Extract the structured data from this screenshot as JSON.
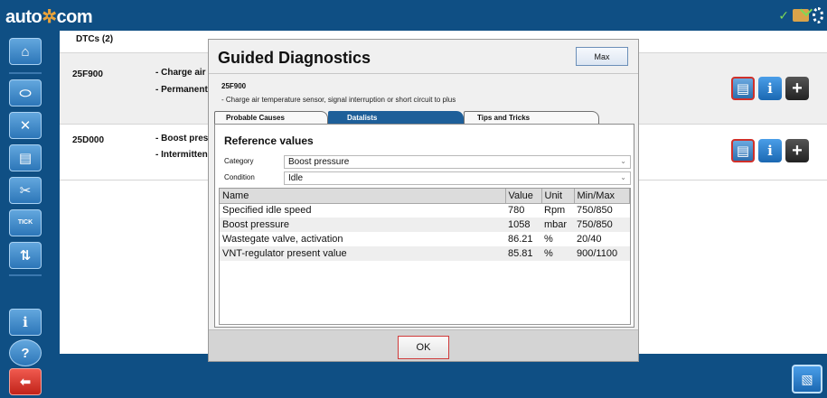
{
  "app": {
    "logo_main": "auto",
    "logo_star": "✲",
    "logo_end": "com"
  },
  "topbar": {
    "check_icon": "check-icon",
    "folder_icon": "folder-icon",
    "gear_icon": "gear-icon"
  },
  "sidebar": {
    "items": [
      {
        "icon": "home-icon",
        "glyph": "⌂"
      },
      {
        "icon": "engine-icon",
        "glyph": "⬭"
      },
      {
        "icon": "vehicle-cross-icon",
        "glyph": "✕"
      },
      {
        "icon": "document-icon",
        "glyph": "▤"
      },
      {
        "icon": "tools-icon",
        "glyph": "✂"
      },
      {
        "icon": "tick-tick-icon",
        "glyph": "TICK"
      },
      {
        "icon": "sync-icon",
        "glyph": "⇅"
      },
      {
        "icon": "info-icon",
        "glyph": "i"
      },
      {
        "icon": "help-icon",
        "glyph": "?"
      },
      {
        "icon": "back-arrow-icon",
        "glyph": "⬅"
      }
    ]
  },
  "main": {
    "tab_label": "DTCs (2)",
    "dtcs": [
      {
        "code": "25F900",
        "lines": [
          "- Charge air",
          "- Permanent"
        ]
      },
      {
        "code": "25D000",
        "lines": [
          "- Boost pres",
          "- Intermitten"
        ]
      }
    ]
  },
  "modal": {
    "title": "Guided Diagnostics",
    "max_label": "Max",
    "code": "25F900",
    "description": "- Charge air temperature sensor, signal interruption or short circuit to plus",
    "tabs": [
      "Probable Causes",
      "Datalists",
      "Tips and Tricks"
    ],
    "active_tab": "Datalists",
    "section_title": "Reference values",
    "category_label": "Category",
    "category_value": "Boost pressure",
    "condition_label": "Condition",
    "condition_value": "Idle",
    "table": {
      "headers": [
        "Name",
        "Value",
        "Unit",
        "Min/Max"
      ],
      "rows": [
        [
          "Specified idle speed",
          "780",
          "Rpm",
          "750/850"
        ],
        [
          "Boost pressure",
          "1058",
          "mbar",
          "750/850"
        ],
        [
          "Wastegate valve, activation",
          "86.21",
          "%",
          "20/40"
        ],
        [
          "VNT-regulator present value",
          "85.81",
          "%",
          "900/1100"
        ]
      ]
    },
    "ok_label": "OK"
  }
}
